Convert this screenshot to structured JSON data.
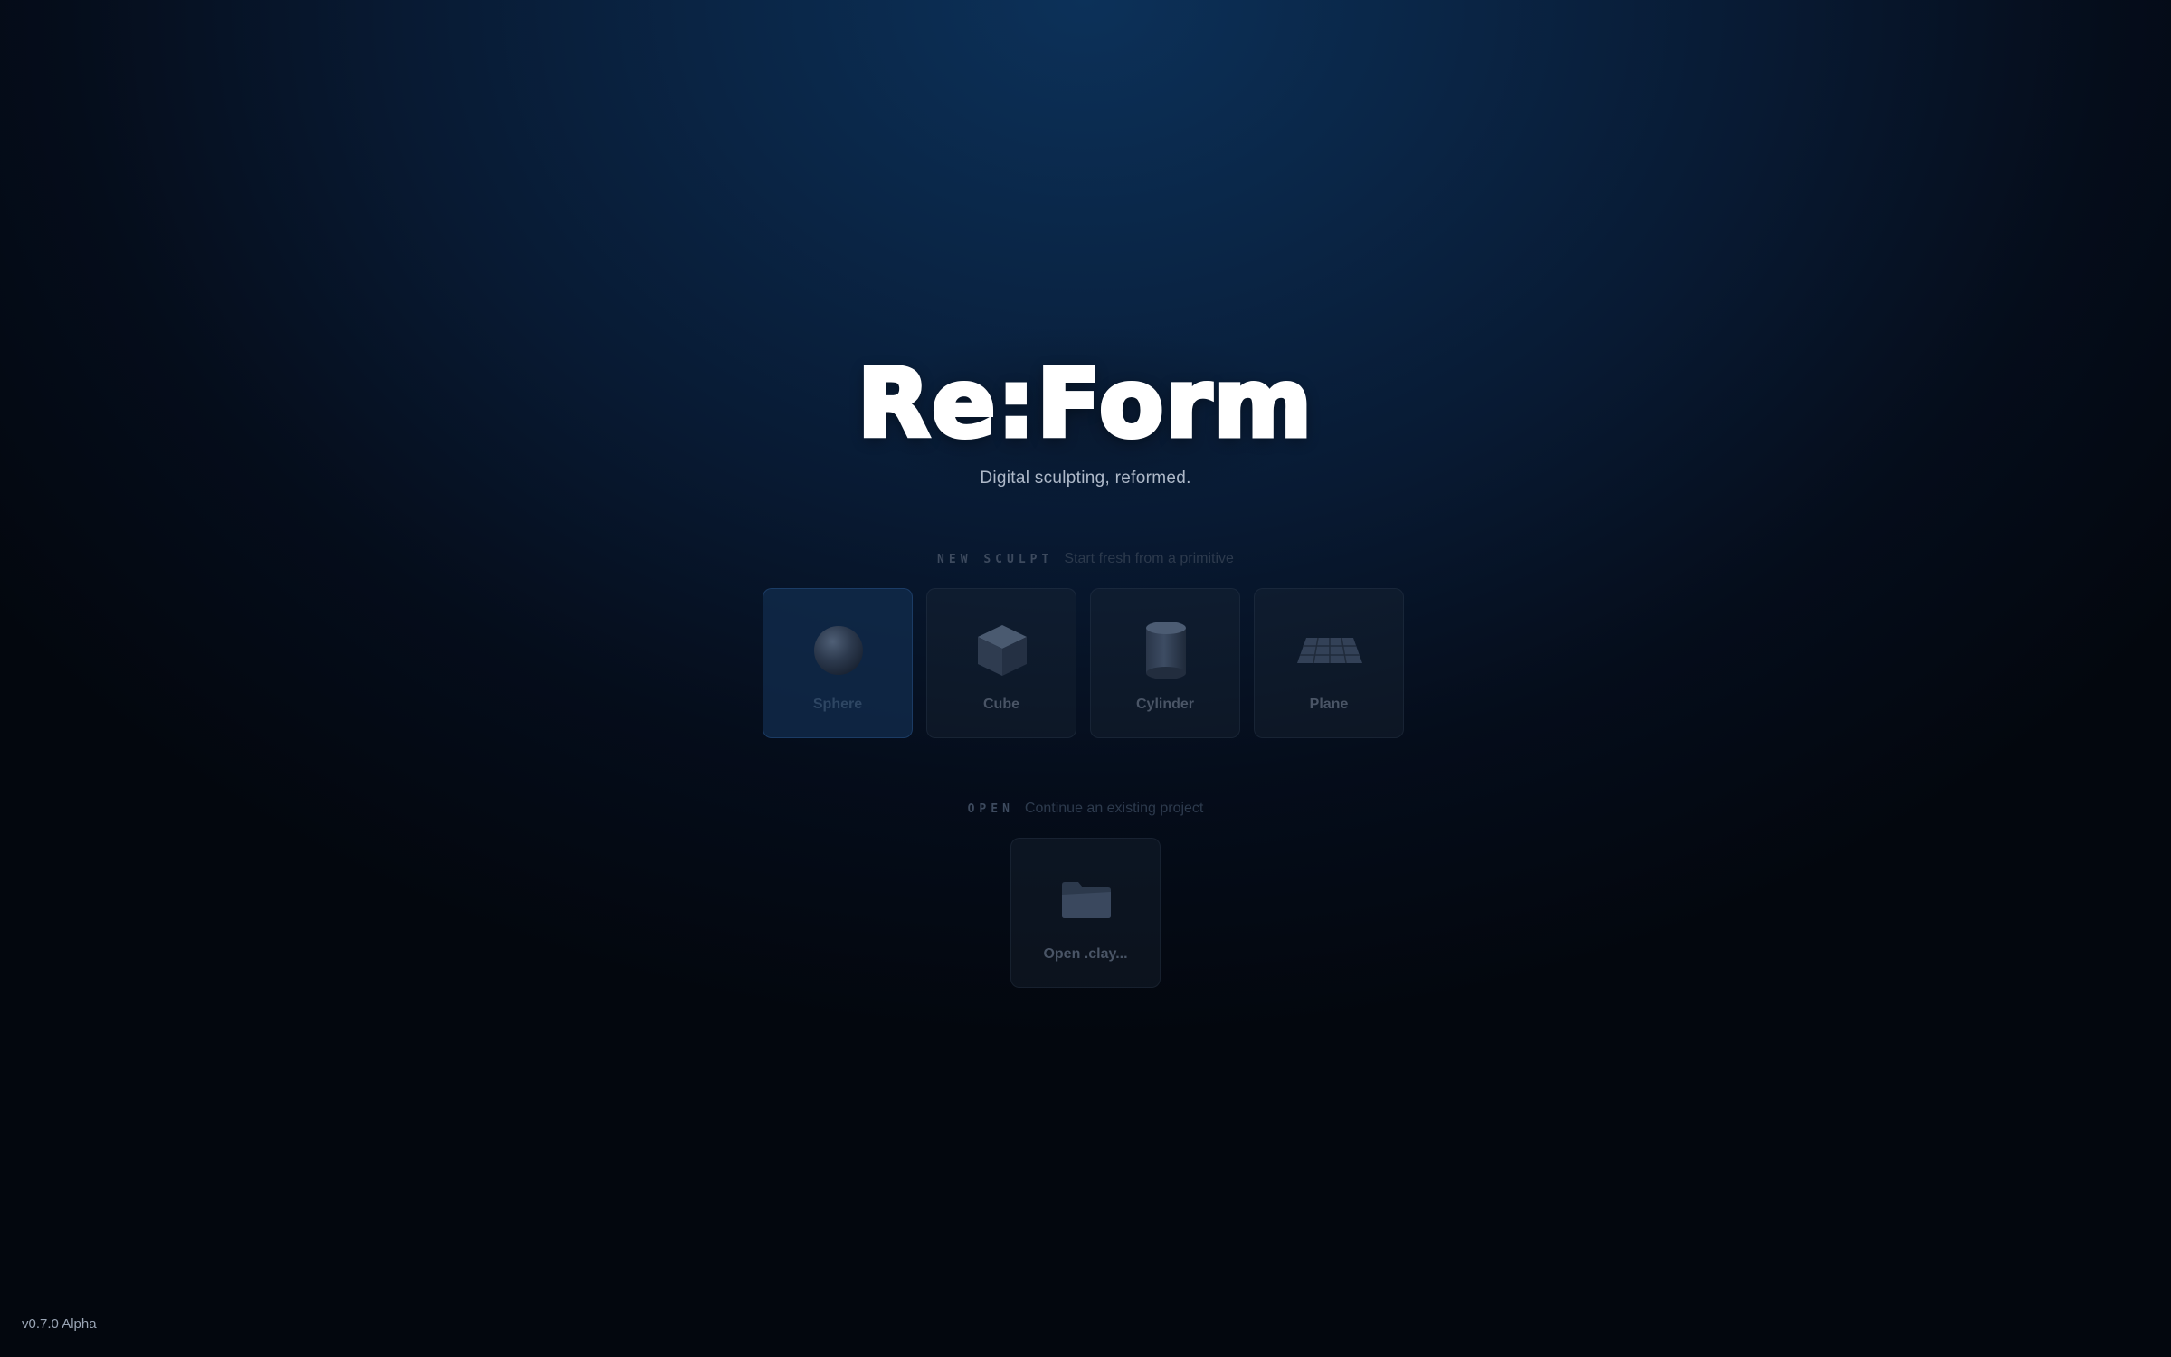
{
  "app": {
    "title": "Re:Form",
    "tagline": "Digital sculpting, reformed.",
    "version": "v0.7.0 Alpha"
  },
  "new_sculpt": {
    "key": "NEW SCULPT",
    "description": "Start fresh from a primitive",
    "primitives": [
      {
        "label": "Sphere",
        "icon": "sphere-icon",
        "selected": true
      },
      {
        "label": "Cube",
        "icon": "cube-icon",
        "selected": false
      },
      {
        "label": "Cylinder",
        "icon": "cylinder-icon",
        "selected": false
      },
      {
        "label": "Plane",
        "icon": "plane-icon",
        "selected": false
      }
    ]
  },
  "open": {
    "key": "OPEN",
    "description": "Continue an existing project",
    "action": {
      "label": "Open .clay...",
      "icon": "folder-icon"
    }
  },
  "colors": {
    "background_top": "#0c3159",
    "background_bottom": "#03070e",
    "tile": "#1e2837",
    "tile_selected": "#122c4e",
    "tagline": "#aeb9c9"
  }
}
